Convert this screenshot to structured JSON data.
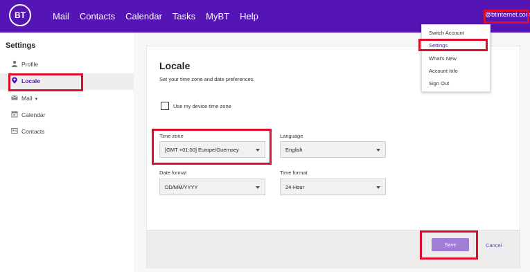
{
  "header": {
    "logo_text": "BT",
    "nav": [
      "Mail",
      "Contacts",
      "Calendar",
      "Tasks",
      "MyBT",
      "Help"
    ],
    "account_label": "@btinternet.com ⌄"
  },
  "account_menu": {
    "items": [
      "Switch Account",
      "Settings",
      "What's New",
      "Account Info",
      "Sign Out"
    ],
    "active": "Settings"
  },
  "sidebar": {
    "title": "Settings",
    "items": [
      {
        "label": "Profile",
        "icon": "person-icon"
      },
      {
        "label": "Locale",
        "icon": "location-pin-icon",
        "active": true
      },
      {
        "label": "Mail",
        "icon": "envelope-icon",
        "caret": "▾"
      },
      {
        "label": "Calendar",
        "icon": "calendar-icon"
      },
      {
        "label": "Contacts",
        "icon": "contacts-card-icon"
      }
    ]
  },
  "locale": {
    "title": "Locale",
    "subtitle": "Set your time zone and date preferences.",
    "device_tz_label": "Use my device time zone",
    "device_tz_checked": false,
    "timezone": {
      "label": "Time zone",
      "value": "[GMT +01:00] Europe/Guernsey"
    },
    "language": {
      "label": "Language",
      "value": "English"
    },
    "date_format": {
      "label": "Date format",
      "value": "DD/MM/YYYY"
    },
    "time_format": {
      "label": "Time format",
      "value": "24-Hour"
    },
    "save_label": "Save",
    "cancel_label": "Cancel"
  },
  "colors": {
    "brand": "#5514b4",
    "highlight": "#e00d2a",
    "save_button": "#a07ed6"
  }
}
